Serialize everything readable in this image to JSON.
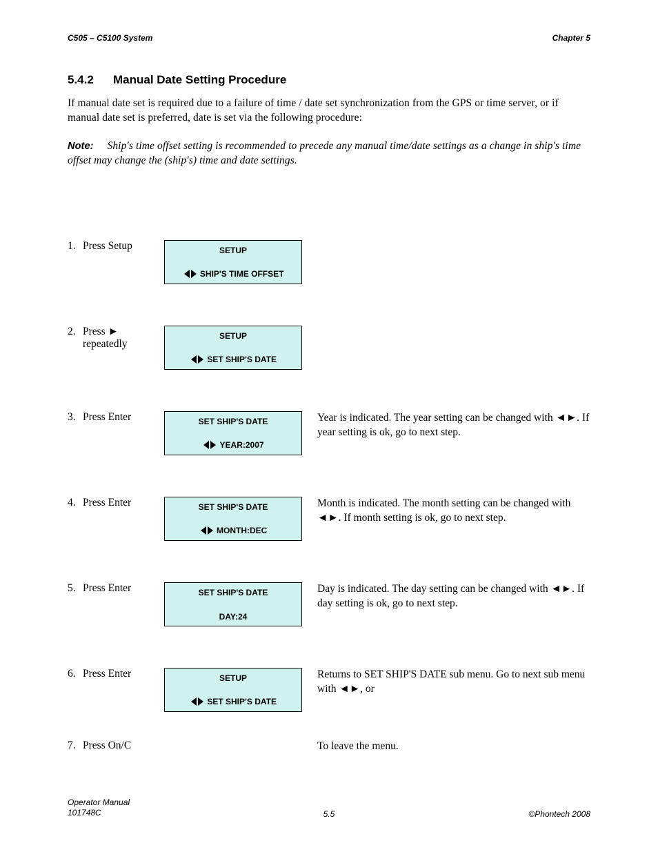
{
  "header": {
    "left": "C505 – C5100 System",
    "right": "Chapter 5"
  },
  "section": {
    "number": "5.4.2",
    "title": "Manual Date Setting Procedure"
  },
  "intro": "If manual date set is required due to a failure of time / date set synchronization from the GPS or time server, or if manual date set is preferred, date is set via the following procedure:",
  "note": {
    "label": "Note:",
    "body": "Ship's time offset setting is recommended to precede any manual time/date settings as a change in ship's time offset may change the (ship's) time and date settings."
  },
  "steps": [
    {
      "n": "1.",
      "label": "Press Setup",
      "panel": {
        "line1": "SETUP",
        "line2_mid": "SHIP'S TIME OFFSET",
        "arrows": true
      },
      "desc": ""
    },
    {
      "n": "2.",
      "label": "Press ► repeatedly",
      "panel": {
        "line1": "SETUP",
        "line2_mid": "SET SHIP'S DATE",
        "arrows": true
      },
      "desc": ""
    },
    {
      "n": "3.",
      "label": "Press Enter",
      "panel": {
        "line1": "SET SHIP'S DATE",
        "line2_mid": "YEAR:2007",
        "arrows": true
      },
      "desc": "Year is indicated. The year setting can be changed with ◄►.  If year setting is ok, go to next step."
    },
    {
      "n": "4.",
      "label": "Press Enter",
      "panel": {
        "line1": "SET SHIP'S DATE",
        "line2_mid": "MONTH:DEC",
        "arrows": true
      },
      "desc": "Month is indicated. The month setting can be changed with ◄►.  If month setting is ok, go to next step."
    },
    {
      "n": "5.",
      "label": "Press Enter",
      "panel": {
        "line1": "SET SHIP'S DATE",
        "line2_plain": "DAY:24",
        "arrows": false
      },
      "desc": "Day is indicated. The day setting can be changed with ◄►.  If day setting is ok, go to next step."
    },
    {
      "n": "6.",
      "label": "Press Enter",
      "panel": {
        "line1": "SETUP",
        "line2_mid": "SET SHIP'S DATE",
        "arrows": true
      },
      "desc": "Returns to SET SHIP'S DATE sub menu. Go to next sub menu with ◄►, or"
    },
    {
      "n": "7.",
      "label": "Press On/C",
      "panel": null,
      "desc": "To leave the menu."
    }
  ],
  "footer": {
    "left_line1": "Operator Manual",
    "left_line2": "101748C",
    "center": "5.5",
    "right": "©Phontech 2008"
  }
}
